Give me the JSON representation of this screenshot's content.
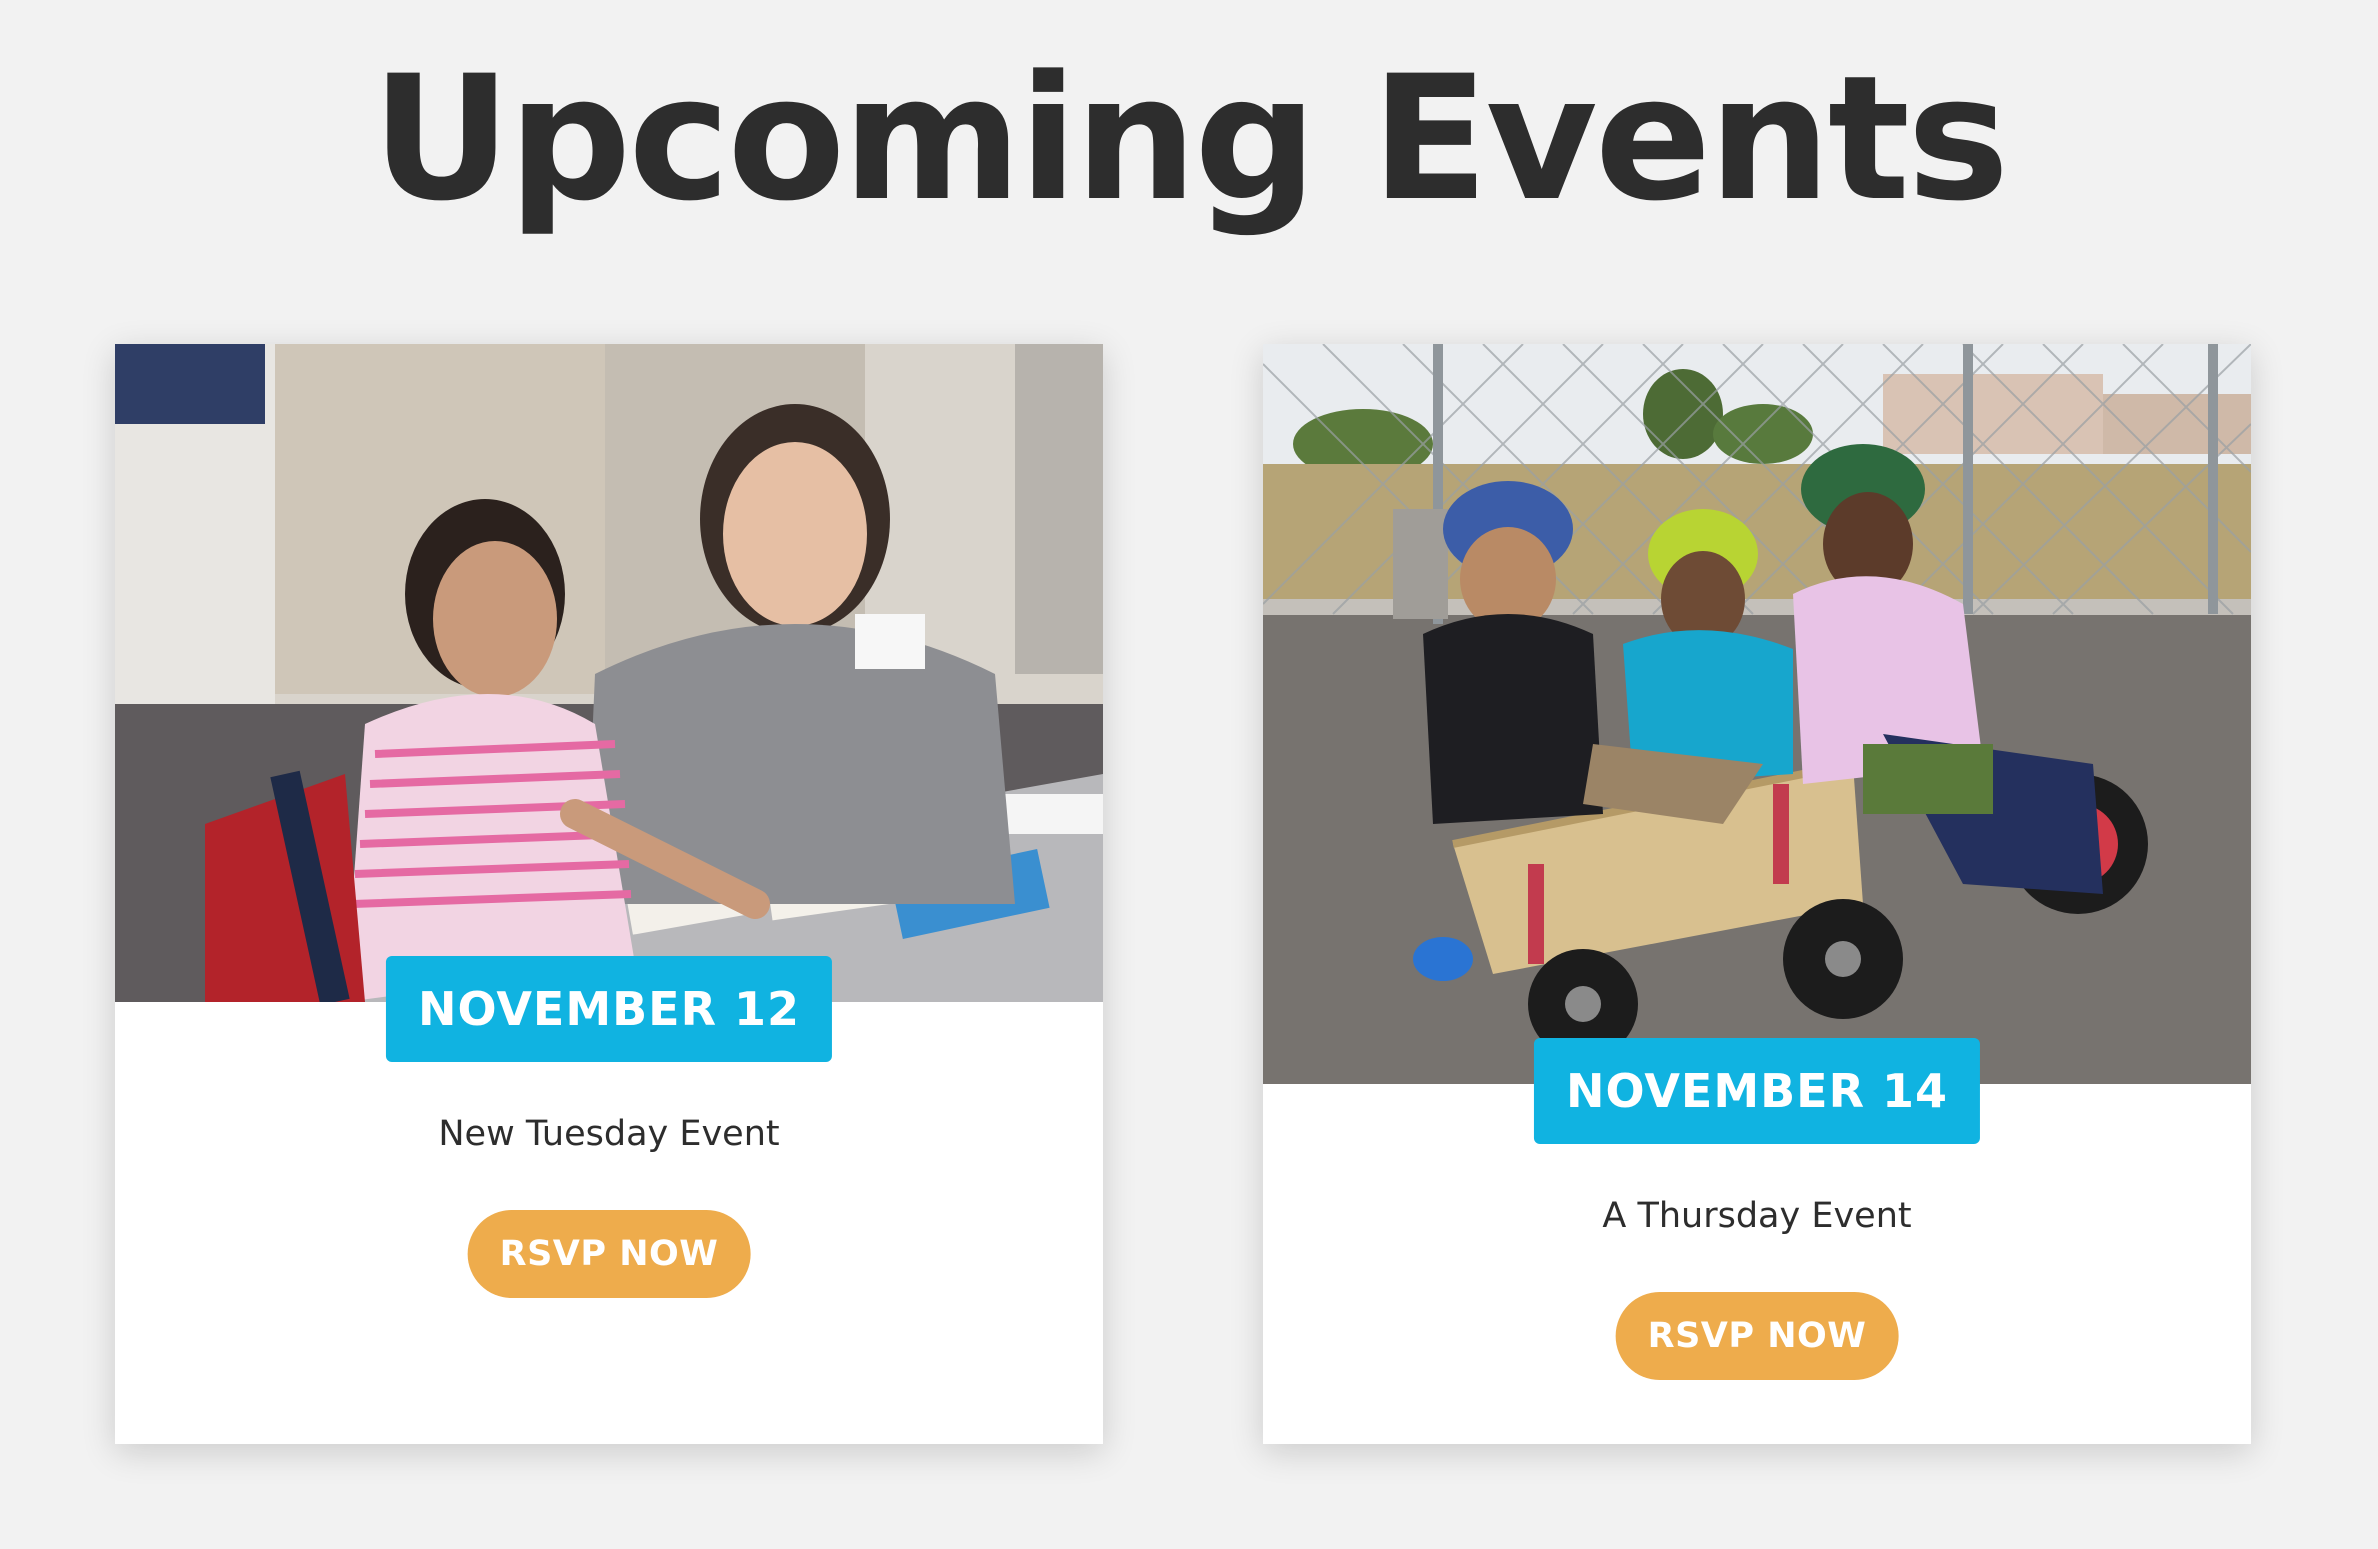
{
  "page": {
    "title": "Upcoming Events"
  },
  "colors": {
    "background": "#f2f2f2",
    "title_text": "#2d2d2d",
    "date_badge": "#10b3e1",
    "rsvp_button": "#eeac4c",
    "card": "#ffffff"
  },
  "events": [
    {
      "date": "NOVEMBER 12",
      "title": "New Tuesday Event",
      "button_label": "RSVP NOW",
      "image": "photo-child-and-volunteer-matching-cards"
    },
    {
      "date": "NOVEMBER 14",
      "title": "A Thursday Event",
      "button_label": "RSVP NOW",
      "image": "photo-three-kids-in-helmets-on-wagon"
    }
  ]
}
